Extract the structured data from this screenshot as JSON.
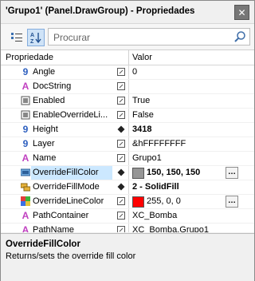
{
  "window": {
    "title": "'Grupo1' (Panel.DrawGroup) - Propriedades"
  },
  "toolbar": {
    "search_placeholder": "Procurar"
  },
  "grid": {
    "col_property": "Propriedade",
    "col_value": "Valor",
    "rows": [
      {
        "name": "Angle",
        "value": "0",
        "type": "number"
      },
      {
        "name": "DocString",
        "value": "",
        "type": "string"
      },
      {
        "name": "Enabled",
        "value": "True",
        "type": "bool"
      },
      {
        "name": "EnableOverrideLi...",
        "value": "False",
        "type": "bool"
      },
      {
        "name": "Height",
        "value": "3418",
        "type": "number"
      },
      {
        "name": "Layer",
        "value": "&hFFFFFFFF",
        "type": "number"
      },
      {
        "name": "Name",
        "value": "Grupo1",
        "type": "string"
      },
      {
        "name": "OverrideFillColor",
        "value": "150, 150, 150",
        "type": "color",
        "swatch": "#969696",
        "selected": true
      },
      {
        "name": "OverrideFillMode",
        "value": "2 - SolidFill",
        "type": "enum"
      },
      {
        "name": "OverrideLineColor",
        "value": "255, 0, 0",
        "type": "palette",
        "swatch": "#ff0000"
      },
      {
        "name": "PathContainer",
        "value": "XC_Bomba",
        "type": "string"
      },
      {
        "name": "PathName",
        "value": "XC_Bomba.Grupo1",
        "type": "string"
      }
    ]
  },
  "description": {
    "title": "OverrideFillColor",
    "text": "Returns/sets the override fill color"
  }
}
